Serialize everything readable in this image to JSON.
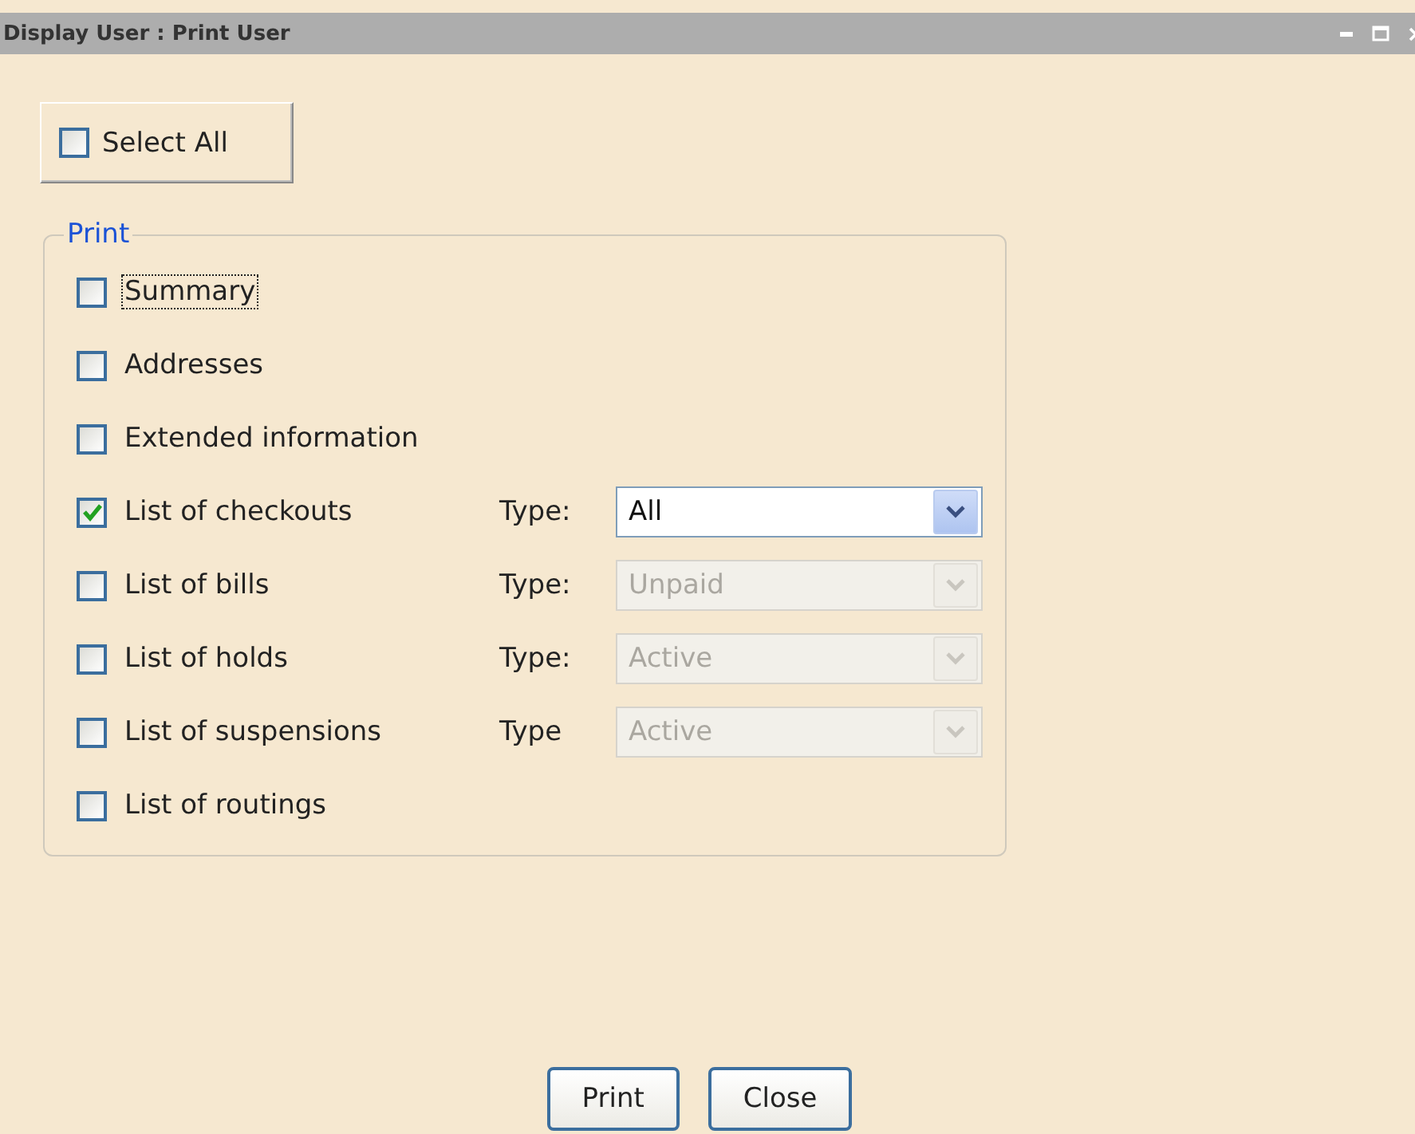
{
  "window": {
    "title": "Display User : Print User"
  },
  "select_all": {
    "label": "Select All",
    "checked": false
  },
  "print_group": {
    "legend": "Print",
    "options": [
      {
        "label": "Summary",
        "checked": false,
        "focused": true
      },
      {
        "label": "Addresses",
        "checked": false,
        "focused": false
      },
      {
        "label": "Extended information",
        "checked": false,
        "focused": false
      },
      {
        "label": "List of checkouts",
        "checked": true,
        "focused": false,
        "type_label": "Type:",
        "type_value": "All",
        "disabled": false
      },
      {
        "label": "List of bills",
        "checked": false,
        "focused": false,
        "type_label": "Type:",
        "type_value": "Unpaid",
        "disabled": true
      },
      {
        "label": "List of holds",
        "checked": false,
        "focused": false,
        "type_label": "Type:",
        "type_value": "Active",
        "disabled": true
      },
      {
        "label": "List of suspensions",
        "checked": false,
        "focused": false,
        "type_label": "Type",
        "type_value": "Active",
        "disabled": true
      },
      {
        "label": "List of routings",
        "checked": false,
        "focused": false
      }
    ]
  },
  "buttons": [
    "Print",
    "Close"
  ]
}
